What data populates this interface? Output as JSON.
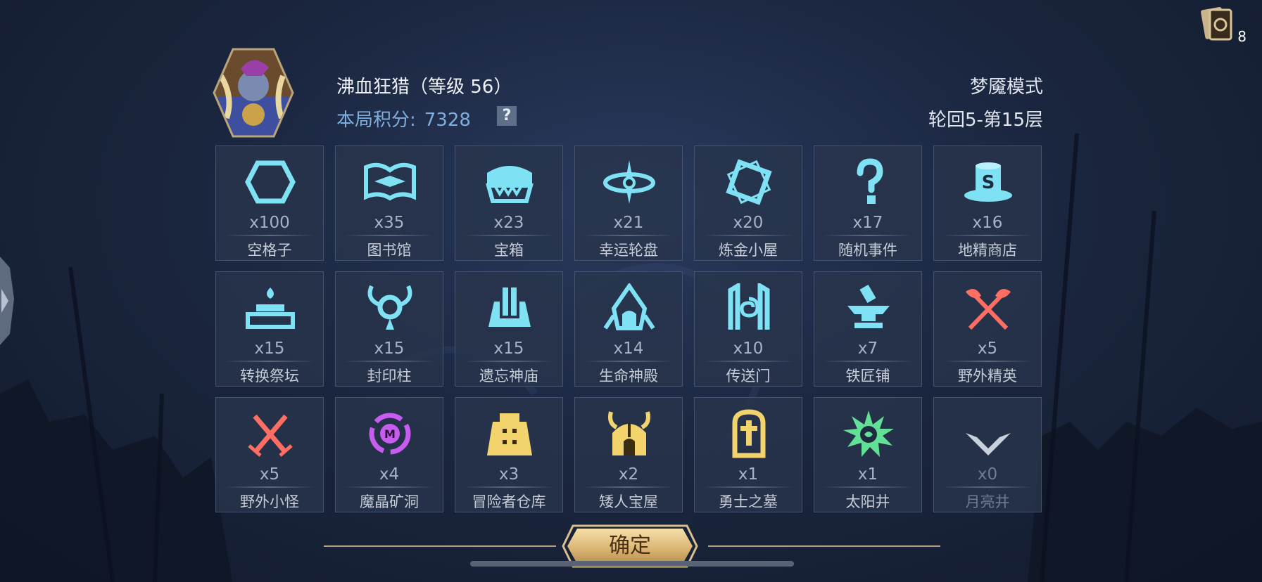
{
  "header": {
    "player_name": "沸血狂猎（等级 56）",
    "score_label": "本局积分:",
    "score_value": "7328",
    "help_label": "?",
    "mode": "梦魇模式",
    "level": "轮回5-第15层",
    "card_count": "8"
  },
  "tiles": [
    {
      "count": "x100",
      "name": "空格子",
      "icon": "hexagon-icon"
    },
    {
      "count": "x35",
      "name": "图书馆",
      "icon": "book-icon"
    },
    {
      "count": "x23",
      "name": "宝箱",
      "icon": "chest-icon"
    },
    {
      "count": "x21",
      "name": "幸运轮盘",
      "icon": "wheel-icon"
    },
    {
      "count": "x20",
      "name": "炼金小屋",
      "icon": "alchemy-icon"
    },
    {
      "count": "x17",
      "name": "随机事件",
      "icon": "question-icon"
    },
    {
      "count": "x16",
      "name": "地精商店",
      "icon": "goblin-shop-icon"
    },
    {
      "count": "x15",
      "name": "转换祭坛",
      "icon": "altar-icon"
    },
    {
      "count": "x15",
      "name": "封印柱",
      "icon": "seal-pillar-icon"
    },
    {
      "count": "x15",
      "name": "遗忘神庙",
      "icon": "temple-icon"
    },
    {
      "count": "x14",
      "name": "生命神殿",
      "icon": "life-shrine-icon"
    },
    {
      "count": "x10",
      "name": "传送门",
      "icon": "portal-icon"
    },
    {
      "count": "x7",
      "name": "铁匠铺",
      "icon": "anvil-icon"
    },
    {
      "count": "x5",
      "name": "野外精英",
      "icon": "axes-icon"
    },
    {
      "count": "x5",
      "name": "野外小怪",
      "icon": "swords-icon"
    },
    {
      "count": "x4",
      "name": "魔晶矿洞",
      "icon": "crystal-mine-icon"
    },
    {
      "count": "x3",
      "name": "冒险者仓库",
      "icon": "warehouse-icon"
    },
    {
      "count": "x2",
      "name": "矮人宝屋",
      "icon": "dwarf-house-icon"
    },
    {
      "count": "x1",
      "name": "勇士之墓",
      "icon": "tomb-icon"
    },
    {
      "count": "x1",
      "name": "太阳井",
      "icon": "sun-well-icon"
    },
    {
      "count": "x0",
      "name": "月亮井",
      "icon": "moon-well-icon"
    }
  ],
  "footer": {
    "confirm_label": "确定"
  },
  "colors": {
    "cyan": "#7fe2f4",
    "red": "#ff6e62",
    "purple": "#c95cf0",
    "gold": "#f2d36c",
    "green": "#62e095",
    "grey": "#c8d0dc"
  }
}
